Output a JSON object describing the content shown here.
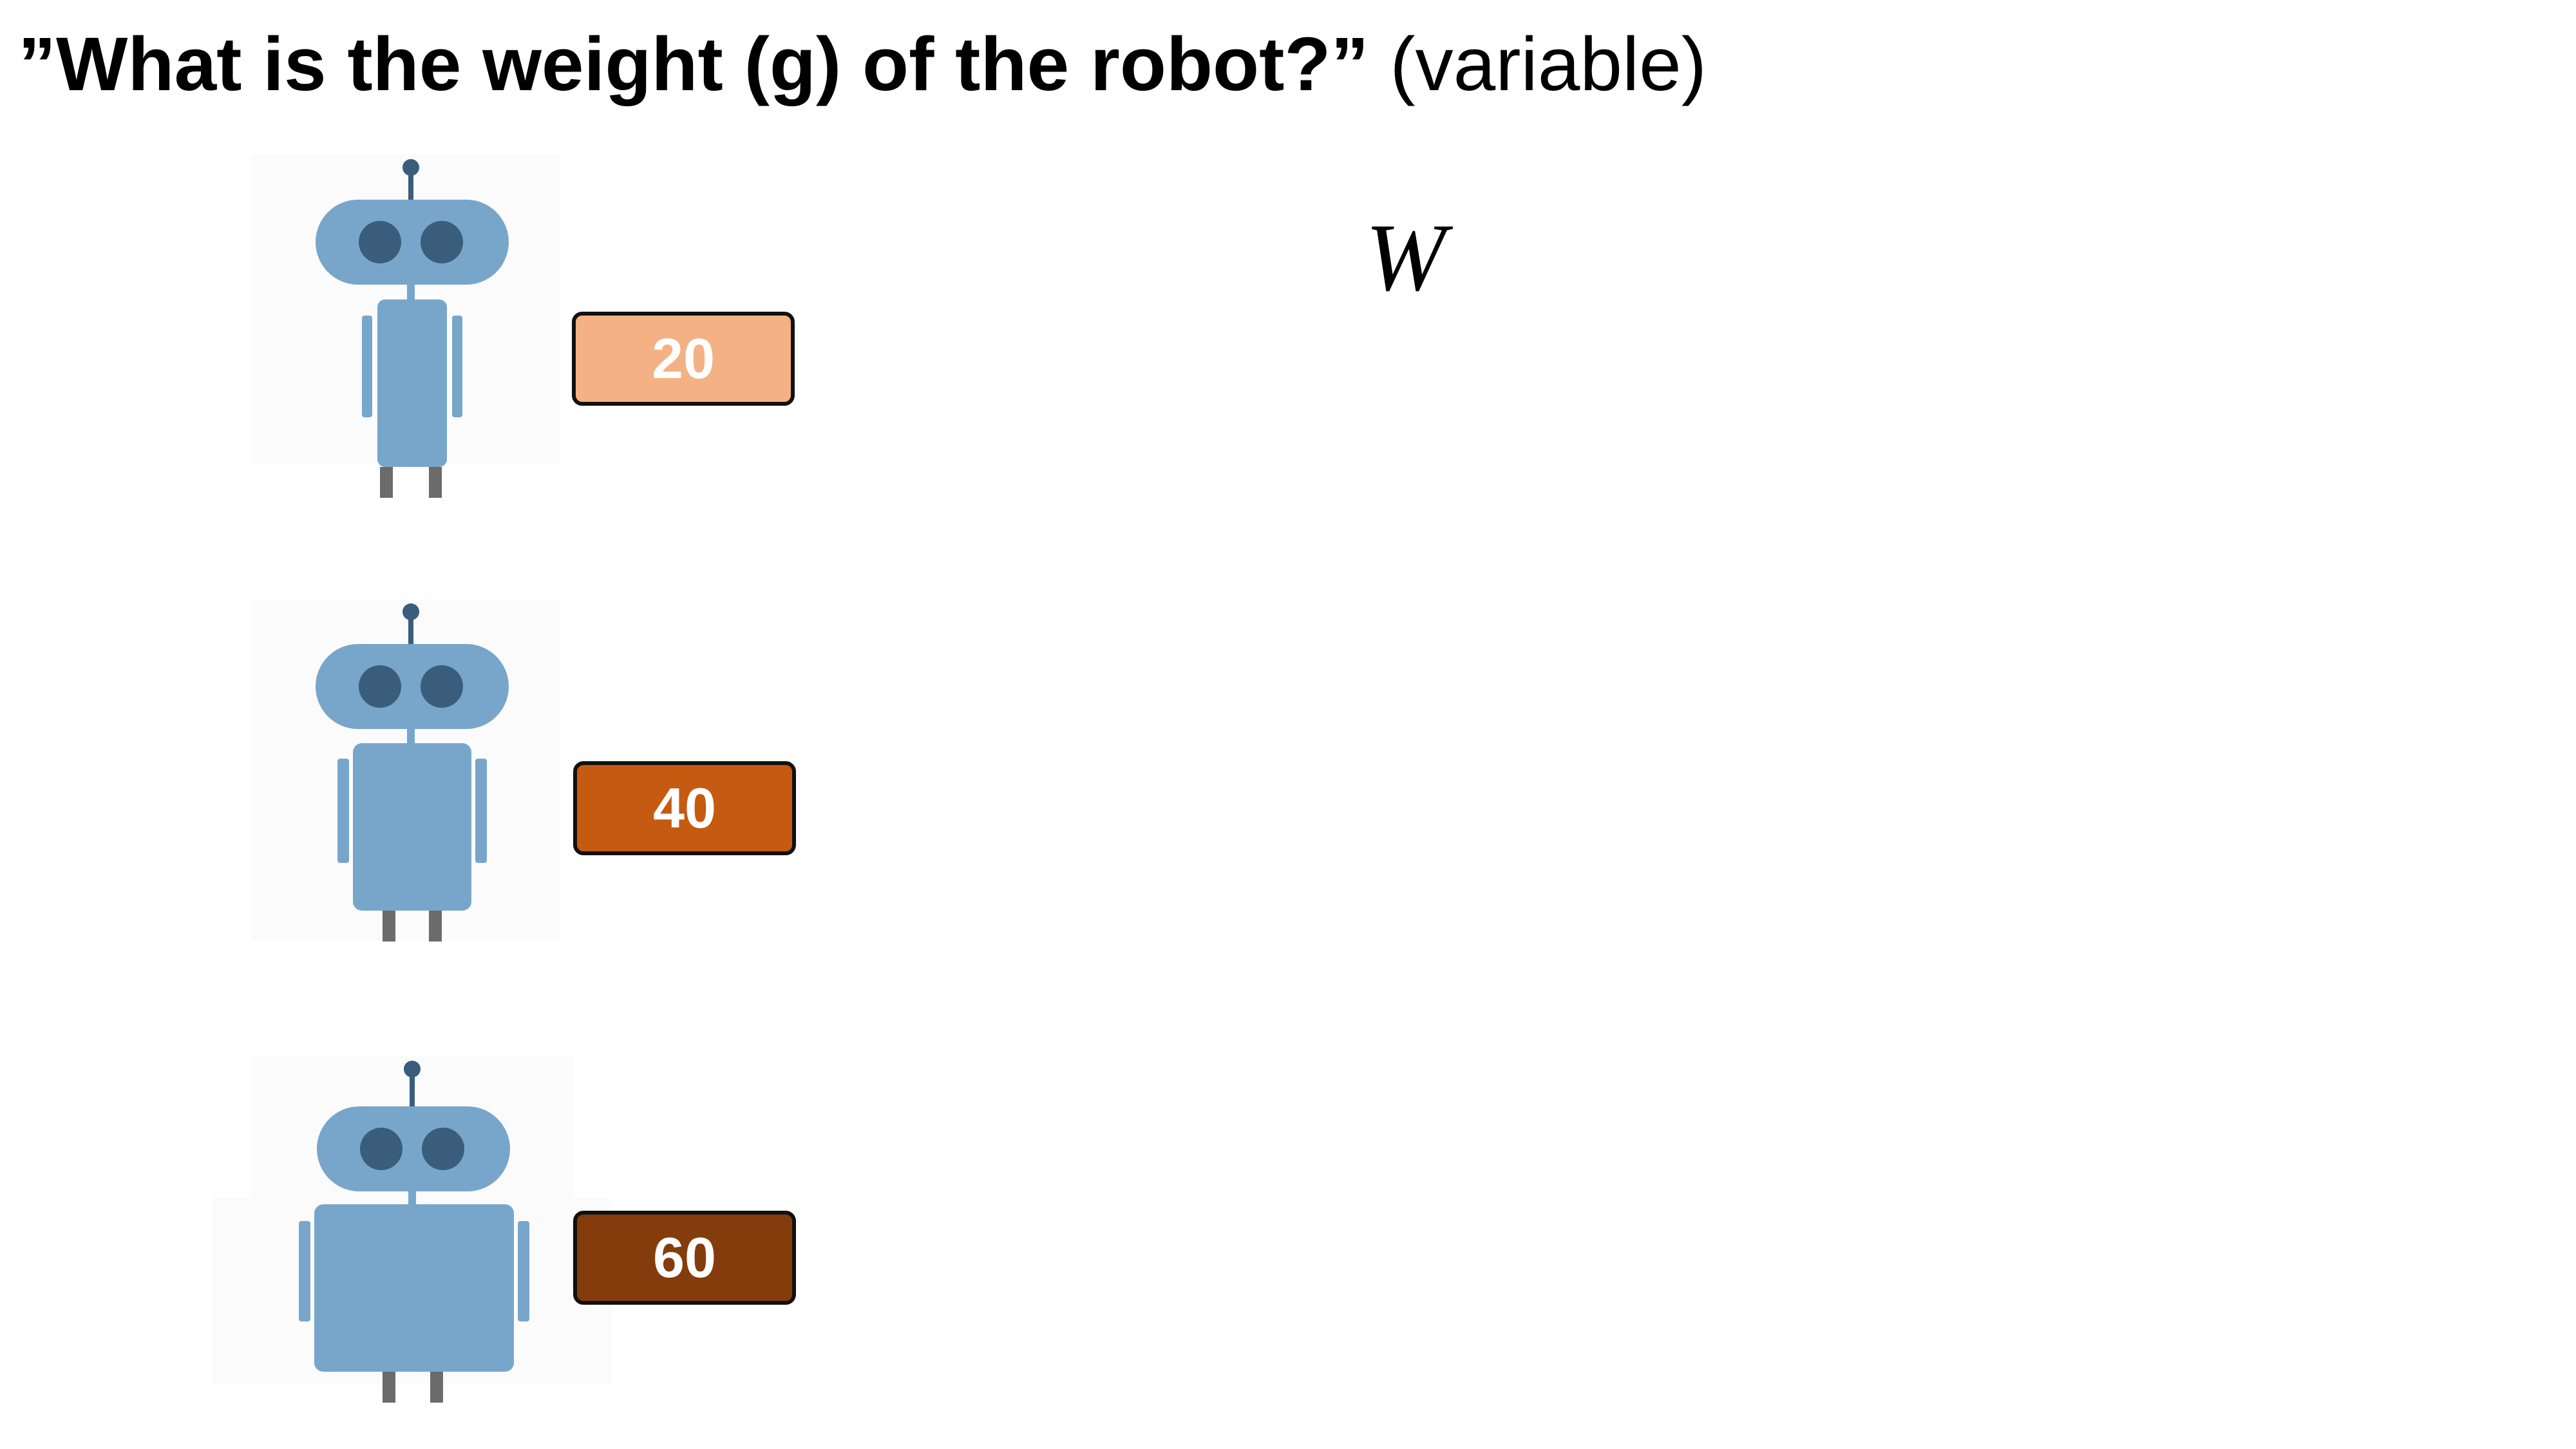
{
  "title": {
    "question": "”What is the weight (g) of the robot?”",
    "tag": " (variable)"
  },
  "variable_symbol": "W",
  "robots": [
    {
      "weight": "20",
      "color": "#f4b183"
    },
    {
      "weight": "40",
      "color": "#c55a11"
    },
    {
      "weight": "60",
      "color": "#843c0c"
    }
  ],
  "colors": {
    "robot_body": "#78a6cb",
    "robot_eyes": "#3a5d7c",
    "robot_legs": "#6b6b6b",
    "label_border": "#111111"
  }
}
